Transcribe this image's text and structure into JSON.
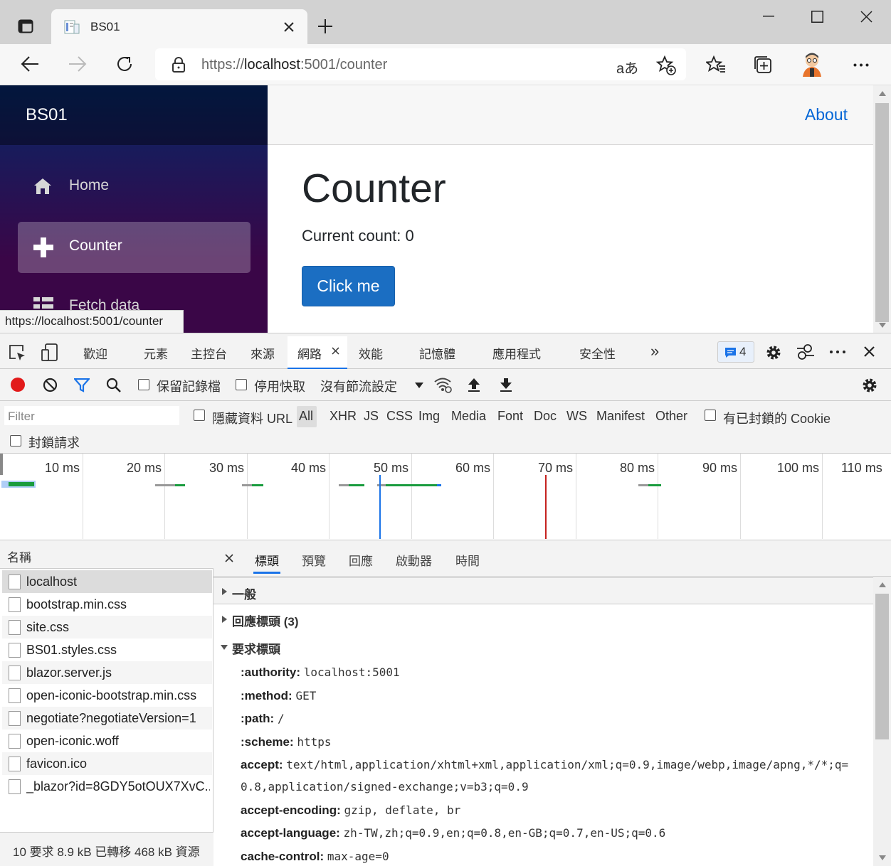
{
  "browser": {
    "tab_title": "BS01",
    "url_prefix": "https://",
    "url_host": "localhost",
    "url_rest": ":5001/counter"
  },
  "app": {
    "brand": "BS01",
    "nav": [
      {
        "label": "Home",
        "icon": "home-icon"
      },
      {
        "label": "Counter",
        "icon": "plus-icon"
      },
      {
        "label": "Fetch data",
        "icon": "list-icon"
      }
    ],
    "about": "About",
    "heading": "Counter",
    "current_count": "Current count: 0",
    "button": "Click me",
    "status_link": "https://localhost:5001/counter"
  },
  "devtools": {
    "tabs": [
      "歡迎",
      "元素",
      "主控台",
      "來源",
      "網路",
      "效能",
      "記憶體",
      "應用程式",
      "安全性"
    ],
    "issues_count": "4",
    "toolbar": {
      "preserve_log": "保留記錄檔",
      "disable_cache": "停用快取",
      "throttling": "沒有節流設定"
    },
    "filter": {
      "placeholder": "Filter",
      "hide_data_urls": "隱藏資料 URL",
      "types": [
        "All",
        "XHR",
        "JS",
        "CSS",
        "Img",
        "Media",
        "Font",
        "Doc",
        "WS",
        "Manifest",
        "Other"
      ],
      "blocked_cookies": "有已封鎖的 Cookie",
      "blocked_requests": "封鎖請求"
    },
    "timeline_ticks": [
      "10 ms",
      "20 ms",
      "30 ms",
      "40 ms",
      "50 ms",
      "60 ms",
      "70 ms",
      "80 ms",
      "90 ms",
      "100 ms",
      "110 ms"
    ],
    "names_header": "名稱",
    "requests": [
      "localhost",
      "bootstrap.min.css",
      "site.css",
      "BS01.styles.css",
      "blazor.server.js",
      "open-iconic-bootstrap.min.css",
      "negotiate?negotiateVersion=1",
      "open-iconic.woff",
      "favicon.ico",
      "_blazor?id=8GDY5otOUX7XvC..."
    ],
    "summary": "10 要求   8.9 kB 已轉移   468 kB 資源",
    "detail_tabs": [
      "標頭",
      "預覽",
      "回應",
      "啟動器",
      "時間"
    ],
    "sections": {
      "general": "一般",
      "response_headers": "回應標頭 (3)",
      "request_headers": "要求標頭"
    },
    "headers": [
      {
        "k": ":authority:",
        "v": "localhost:5001"
      },
      {
        "k": ":method:",
        "v": "GET"
      },
      {
        "k": ":path:",
        "v": "/"
      },
      {
        "k": ":scheme:",
        "v": "https"
      },
      {
        "k": "accept:",
        "v": "text/html,application/xhtml+xml,application/xml;q=0.9,image/webp,image/apng,*/*;q="
      },
      {
        "k": "",
        "v": "0.8,application/signed-exchange;v=b3;q=0.9"
      },
      {
        "k": "accept-encoding:",
        "v": "gzip, deflate, br"
      },
      {
        "k": "accept-language:",
        "v": "zh-TW,zh;q=0.9,en;q=0.8,en-GB;q=0.7,en-US;q=0.6"
      },
      {
        "k": "cache-control:",
        "v": "max-age=0"
      }
    ]
  }
}
